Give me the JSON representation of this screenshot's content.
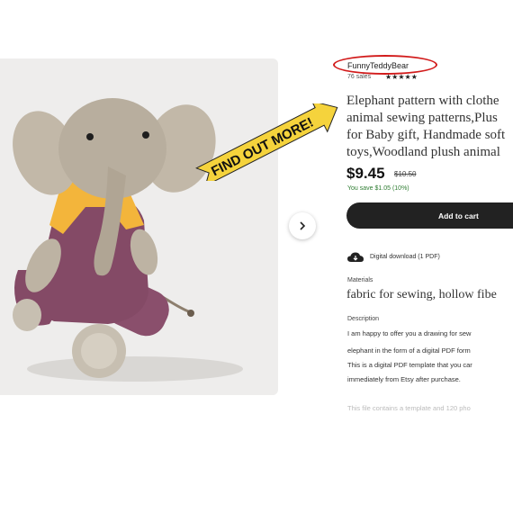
{
  "shop": {
    "name": "FunnyTeddyBear",
    "sales": "76 sales",
    "stars": "★★★★★"
  },
  "product": {
    "title_lines": [
      "Elephant pattern with clothe",
      "animal sewing patterns,Plus",
      "for Baby gift, Handmade soft",
      "toys,Woodland plush animal"
    ],
    "price": "$9.45",
    "old_price": "$10.50",
    "savings": "You save $1.05 (10%)",
    "cart_label": "Add to cart",
    "download": "Digital download (1 PDF)",
    "materials_label": "Materials",
    "materials_value": "fabric for sewing, hollow fibe",
    "description_label": "Description",
    "description_lines": [
      "I am happy to offer you a drawing for sew",
      "elephant in the form of a digital PDF form",
      "This is a digital PDF template that you car",
      "immediately from Etsy after purchase.",
      "",
      "This file contains a template and 120 pho"
    ]
  },
  "banner": {
    "text": "FIND OUT MORE!",
    "color": "#f5d33c"
  },
  "colors": {
    "oval": "#d21b1b",
    "cart_bg": "#222222",
    "savings": "#2f7d32"
  },
  "icons": {
    "next": "chevron-right-icon",
    "download": "cloud-download-icon"
  }
}
